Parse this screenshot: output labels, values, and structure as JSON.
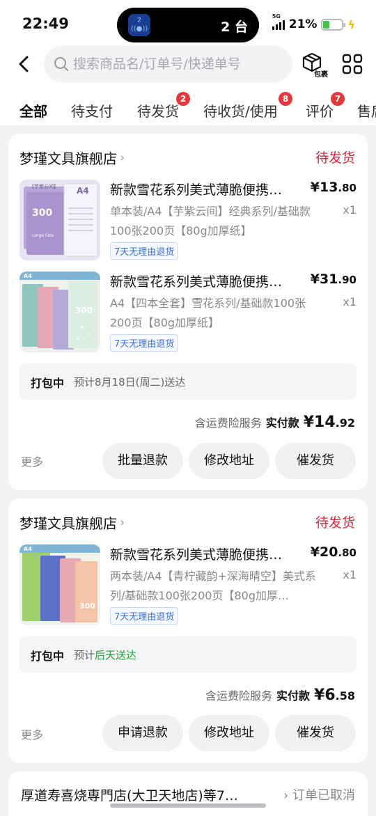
{
  "status_bar": {
    "time": "22:49",
    "island_count": "2 台",
    "island_app_badge": "2",
    "network": "5G",
    "battery": "21%"
  },
  "search": {
    "placeholder": "搜索商品名/订单号/快递单号"
  },
  "package_label": "包裹",
  "tabs": [
    {
      "label": "全部",
      "badge": ""
    },
    {
      "label": "待支付",
      "badge": ""
    },
    {
      "label": "待发货",
      "badge": "2"
    },
    {
      "label": "待收货/使用",
      "badge": "8"
    },
    {
      "label": "评价",
      "badge": "7"
    },
    {
      "label": "售后",
      "badge": ""
    }
  ],
  "orders": [
    {
      "shop": "梦瑾文具旗舰店",
      "status": "待发货",
      "items": [
        {
          "title": "新款雪花系列美式薄脆便携…",
          "price_int": "¥13",
          "price_dec": ".80",
          "spec": "单本装/A4【芋紫云间】经典系列/基础款100张200页【80g加厚纸】",
          "qty": "x1",
          "tag": "7天无理由退货"
        },
        {
          "title": "新款雪花系列美式薄脆便携…",
          "price_int": "¥31",
          "price_dec": ".90",
          "spec": "A4【四本全套】雪花系列/基础款100张200页【80g加厚纸】",
          "qty": "x1",
          "tag": "7天无理由退货"
        }
      ],
      "pack_key": "打包中",
      "pack_val": "预计8月18日(周二)送达",
      "insurance": "含运费险服务",
      "paid_label": "实付款",
      "total_int": "¥14",
      "total_dec": ".92",
      "more": "更多",
      "buttons": [
        "批量退款",
        "修改地址",
        "催发货"
      ]
    },
    {
      "shop": "梦瑾文具旗舰店",
      "status": "待发货",
      "items": [
        {
          "title": "新款雪花系列美式薄脆便携…",
          "price_int": "¥20",
          "price_dec": ".80",
          "spec": "两本装/A4【青柠藏韵+深海晴空】美式系列/基础款100张200页【80g加厚…",
          "qty": "x1",
          "tag": "7天无理由退货"
        }
      ],
      "pack_key": "打包中",
      "pack_val_prefix": "预计",
      "pack_val_green": "后天送达",
      "insurance": "含运费险服务",
      "paid_label": "实付款",
      "total_int": "¥6",
      "total_dec": ".58",
      "more": "更多",
      "buttons": [
        "申请退款",
        "修改地址",
        "催发货"
      ]
    }
  ],
  "third_card": {
    "title": "厚道寿喜烧専門店(大卫天地店)等7…",
    "status": "订单已取消"
  },
  "thumb_texts": {
    "a4": "A4",
    "num300": "300",
    "purple_tag": "【芋紫云间】",
    "large": "Large Size"
  }
}
